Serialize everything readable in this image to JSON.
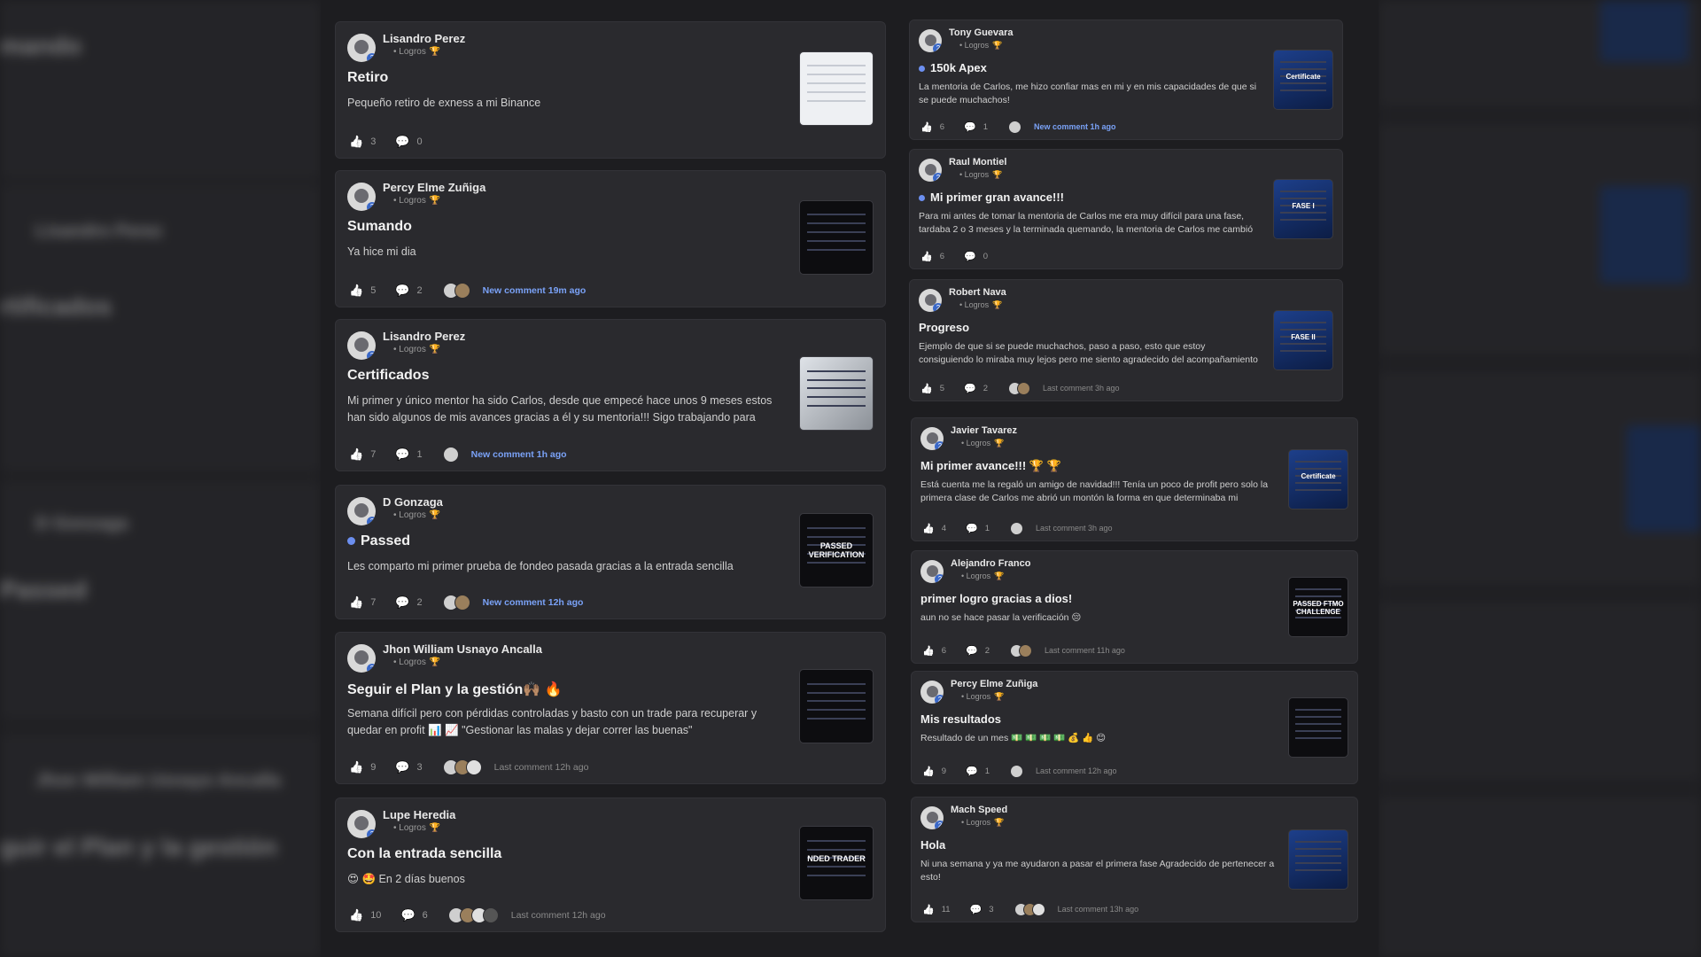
{
  "feed": {
    "left": [
      {
        "author": "Lisandro Perez",
        "category": "Logros",
        "title": "Retiro",
        "has_dot": false,
        "body": "Pequeño retiro de exness a mi Binance",
        "likes": "3",
        "comments": "0",
        "activity": "",
        "activity_type": "",
        "avatars": 0,
        "thumb_icon": "receipt-screenshot-thumbnail"
      },
      {
        "author": "Percy Elme Zuñiga",
        "category": "Logros",
        "title": "Sumando",
        "has_dot": false,
        "body": "Ya hice mi dia",
        "likes": "5",
        "comments": "2",
        "activity": "New comment 19m ago",
        "activity_type": "new",
        "avatars": 2,
        "thumb_icon": "chart-dark-thumbnail"
      },
      {
        "author": "Lisandro Perez",
        "category": "Logros",
        "title": "Certificados",
        "has_dot": false,
        "body": "Mi primer y único mentor ha sido Carlos, desde que empecé hace unos 9 meses estos han sido algunos de mis avances gracias a él y su mentoria!!! Sigo trabajando para",
        "likes": "7",
        "comments": "1",
        "activity": "New comment 1h ago",
        "activity_type": "new",
        "avatars": 1,
        "thumb_icon": "certificates-photo-thumbnail"
      },
      {
        "author": "D Gonzaga",
        "category": "Logros",
        "title": "Passed",
        "has_dot": true,
        "body": "Les comparto mi primer prueba de fondeo pasada gracias a la entrada sencilla",
        "likes": "7",
        "comments": "2",
        "activity": "New comment 12h ago",
        "activity_type": "new",
        "avatars": 2,
        "thumb_icon": "passed-verification-thumbnail"
      },
      {
        "author": "Jhon William Usnayo Ancalla",
        "category": "Logros",
        "title": "Seguir el Plan y la gestión🙌🏽 🔥",
        "has_dot": false,
        "body": "Semana difícil pero con pérdidas controladas y basto con un trade para recuperar y quedar en profit 📊 📈 \"Gestionar las malas y dejar correr las buenas\"",
        "likes": "9",
        "comments": "3",
        "activity": "Last comment 12h ago",
        "activity_type": "last",
        "avatars": 3,
        "thumb_icon": "trade-list-thumbnail"
      },
      {
        "author": "Lupe Heredia",
        "category": "Logros",
        "title": "Con la entrada sencilla",
        "has_dot": false,
        "body": "😍 🤩 En 2 días buenos",
        "likes": "10",
        "comments": "6",
        "activity": "Last comment 12h ago",
        "activity_type": "last",
        "avatars": 4,
        "thumb_icon": "funded-trader-thumbnail"
      }
    ],
    "right": [
      {
        "author": "Tony Guevara",
        "category": "Logros",
        "title": "150k Apex",
        "has_dot": true,
        "body": "La mentoria de Carlos, me hizo confiar mas en mi y en mis capacidades de que si se puede muchachos!",
        "likes": "6",
        "comments": "1",
        "activity": "New comment 1h ago",
        "activity_type": "new",
        "avatars": 1,
        "thumb_icon": "certificate-thumbnail"
      },
      {
        "author": "Raul Montiel",
        "category": "Logros",
        "title": "Mi primer gran avance!!!",
        "has_dot": true,
        "body": "Para mi antes de tomar la mentoria de Carlos me era muy difícil para una fase, tardaba 2 o 3 meses y la terminada quemando, la mentoria de Carlos me cambió la mente y",
        "likes": "6",
        "comments": "0",
        "activity": "",
        "activity_type": "",
        "avatars": 0,
        "thumb_icon": "fase-i-thumbnail"
      },
      {
        "author": "Robert Nava",
        "category": "Logros",
        "title": "Progreso",
        "has_dot": false,
        "body": "Ejemplo de que si se puede muchachos, paso a paso, esto que estoy consiguiendo lo miraba muy lejos pero me siento agradecido del acompañamiento de Carlos y la",
        "likes": "5",
        "comments": "2",
        "activity": "Last comment 3h ago",
        "activity_type": "last",
        "avatars": 2,
        "thumb_icon": "fase-ii-thumbnail"
      },
      {
        "author": "Javier Tavarez",
        "category": "Logros",
        "title": "Mi primer avance!!! 🏆 🏆",
        "has_dot": false,
        "body": "Está cuenta me la regaló un amigo de navidad!!! Tenía un poco de profit pero solo la primera clase de Carlos me abrió un montón la forma en que determinaba mi",
        "likes": "4",
        "comments": "1",
        "activity": "Last comment 3h ago",
        "activity_type": "last",
        "avatars": 1,
        "thumb_icon": "certificate-thumbnail"
      },
      {
        "author": "Alejandro Franco",
        "category": "Logros",
        "title": "primer logro gracias a dios!",
        "has_dot": false,
        "body": "aun no se hace pasar la verificación 😔",
        "likes": "6",
        "comments": "2",
        "activity": "Last comment 11h ago",
        "activity_type": "last",
        "avatars": 2,
        "thumb_icon": "ftmo-challenge-thumbnail"
      },
      {
        "author": "Percy Elme Zuñiga",
        "category": "Logros",
        "title": "Mis resultados",
        "has_dot": false,
        "body": "Resultado de un mes 💵 💵 💵 💵 💰 👍 😊",
        "likes": "9",
        "comments": "1",
        "activity": "Last comment 12h ago",
        "activity_type": "last",
        "avatars": 1,
        "thumb_icon": "results-table-thumbnail"
      },
      {
        "author": "Mach Speed",
        "category": "Logros",
        "title": "Hola",
        "has_dot": false,
        "body": "Ni una semana y ya me ayudaron a pasar el primera fase Agradecido de pertenecer a esto!",
        "likes": "11",
        "comments": "3",
        "activity": "Last comment 13h ago",
        "activity_type": "last",
        "avatars": 3,
        "thumb_icon": "congratulations-thumbnail"
      }
    ]
  },
  "thumb_labels": {
    "passed": "PASSED VERIFICATION",
    "funded": "NDED TRADER",
    "fase1": "FASE I",
    "fase2": "FASE II",
    "cert": "Certificate",
    "ftmo": "PASSED FTMO CHALLENGE"
  },
  "colors": {
    "accent": "#7aa2f7",
    "dot": "#6c8ff0",
    "trophy": "#d6a33a",
    "card": "#2a2a2e",
    "page": "#1d1d20"
  }
}
